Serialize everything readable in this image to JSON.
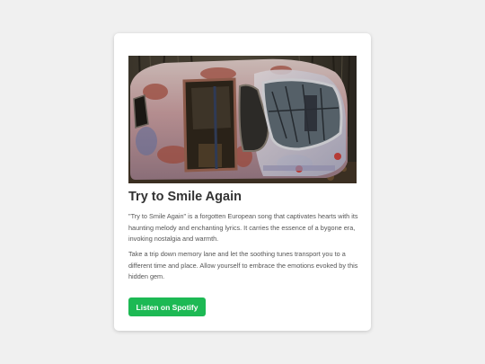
{
  "song": {
    "image_subject": "Abandoned rusty vehicle with broken windows in a forest",
    "title": "Try to Smile Again",
    "description_1": "\"Try to Smile Again\" is a forgotten European song that captivates hearts with its haunting melody and enchanting lyrics. It carries the essence of a bygone era, invoking nostalgia and warmth.",
    "description_2": "Take a trip down memory lane and let the soothing tunes transport you to a different time and place. Allow yourself to embrace the emotions evoked by this hidden gem.",
    "button_label": "Listen on Spotify"
  },
  "colors": {
    "page_background": "#f0f0f0",
    "card_background": "#ffffff",
    "title": "#333333",
    "body_text": "#555555",
    "button_background": "#1db954",
    "button_text": "#ffffff"
  }
}
